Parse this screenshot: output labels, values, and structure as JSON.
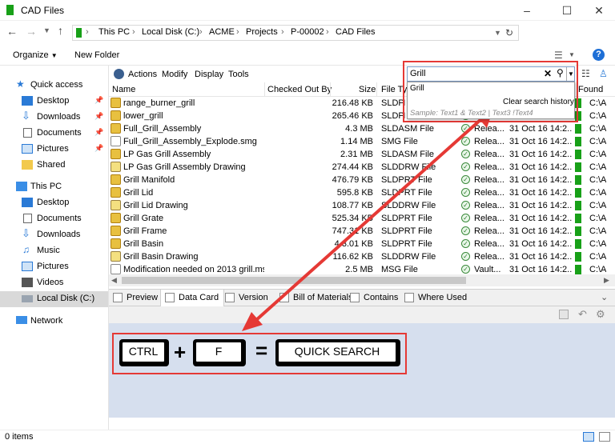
{
  "window": {
    "title": "CAD Files"
  },
  "address": {
    "crumbs": [
      "This PC",
      "Local Disk (C:)",
      "ACME",
      "Projects",
      "P-00002",
      "CAD Files"
    ]
  },
  "toolbar": {
    "organize": "Organize",
    "new_folder": "New Folder",
    "help": "?"
  },
  "sidebar": {
    "quick_access": "Quick access",
    "qa_items": [
      "Desktop",
      "Downloads",
      "Documents",
      "Pictures",
      "Shared"
    ],
    "this_pc": "This PC",
    "pc_items": [
      "Desktop",
      "Documents",
      "Downloads",
      "Music",
      "Pictures",
      "Videos",
      "Local Disk (C:)"
    ],
    "network": "Network"
  },
  "vault_menu": {
    "items": [
      "Actions",
      "Modify",
      "Display",
      "Tools"
    ]
  },
  "search": {
    "query": "Grill",
    "history_item": "Grill",
    "clear_history": "Clear search history",
    "sample": "Sample: Text1 & Text2 | Text3 !Text4"
  },
  "columns": {
    "name": "Name",
    "checked_out_by": "Checked Out By",
    "size": "Size",
    "file_type": "File Type",
    "found": "Found"
  },
  "files": [
    {
      "name": "range_burner_grill",
      "size": "216.48 KB",
      "type": "SLDPRT File",
      "state": "",
      "date": "",
      "path": "C:\\A",
      "icon": "part"
    },
    {
      "name": "lower_grill",
      "size": "265.46 KB",
      "type": "SLDPRT File",
      "state": "Relea...",
      "date": "",
      "path": "C:\\A",
      "icon": "part"
    },
    {
      "name": "Full_Grill_Assembly",
      "size": "4.3 MB",
      "type": "SLDASM File",
      "state": "Relea...",
      "date": "31 Oct 16 14:2...",
      "path": "C:\\A",
      "icon": "asm"
    },
    {
      "name": "Full_Grill_Assembly_Explode.smg",
      "size": "1.14 MB",
      "type": "SMG File",
      "state": "Relea...",
      "date": "31 Oct 16 14:2...",
      "path": "C:\\A",
      "icon": "doc"
    },
    {
      "name": "LP Gas Grill Assembly",
      "size": "2.31 MB",
      "type": "SLDASM File",
      "state": "Relea...",
      "date": "31 Oct 16 14:2...",
      "path": "C:\\A",
      "icon": "asm"
    },
    {
      "name": "LP Gas Grill Assembly Drawing",
      "size": "274.44 KB",
      "type": "SLDDRW File",
      "state": "Relea...",
      "date": "31 Oct 16 14:2...",
      "path": "C:\\A",
      "icon": "drw"
    },
    {
      "name": "Grill Manifold",
      "size": "476.79 KB",
      "type": "SLDPRT File",
      "state": "Relea...",
      "date": "31 Oct 16 14:2...",
      "path": "C:\\A",
      "icon": "part"
    },
    {
      "name": "Grill Lid",
      "size": "595.8 KB",
      "type": "SLDPRT File",
      "state": "Relea...",
      "date": "31 Oct 16 14:2...",
      "path": "C:\\A",
      "icon": "part"
    },
    {
      "name": "Grill Lid Drawing",
      "size": "108.77 KB",
      "type": "SLDDRW File",
      "state": "Relea...",
      "date": "31 Oct 16 14:2...",
      "path": "C:\\A",
      "icon": "drw"
    },
    {
      "name": "Grill Grate",
      "size": "525.34 KB",
      "type": "SLDPRT File",
      "state": "Relea...",
      "date": "31 Oct 16 14:2...",
      "path": "C:\\A",
      "icon": "part"
    },
    {
      "name": "Grill Frame",
      "size": "747.31 KB",
      "type": "SLDPRT File",
      "state": "Relea...",
      "date": "31 Oct 16 14:2...",
      "path": "C:\\A",
      "icon": "part"
    },
    {
      "name": "Grill Basin",
      "size": "4.3.01 KB",
      "type": "SLDPRT File",
      "state": "Relea...",
      "date": "31 Oct 16 14:2...",
      "path": "C:\\A",
      "icon": "part"
    },
    {
      "name": "Grill Basin Drawing",
      "size": "116.62 KB",
      "type": "SLDDRW File",
      "state": "Relea...",
      "date": "31 Oct 16 14:2...",
      "path": "C:\\A",
      "icon": "drw"
    },
    {
      "name": "Modification needed on 2013 grill.msg",
      "size": "2.5 MB",
      "type": "MSG File",
      "state": "Vault...",
      "date": "31 Oct 16 14:2...",
      "path": "C:\\A",
      "icon": "doc"
    }
  ],
  "tabs": [
    "Preview",
    "Data Card",
    "Version",
    "Bill of Materials",
    "Contains",
    "Where Used"
  ],
  "shortcut": {
    "key1": "CTRL",
    "plus": "+",
    "key2": "F",
    "equals": "=",
    "result": "QUICK SEARCH"
  },
  "status": {
    "items": "0 items"
  },
  "colors": {
    "highlight": "#e53935",
    "card_bg": "#d6dfee",
    "vault_green": "#18a018"
  }
}
